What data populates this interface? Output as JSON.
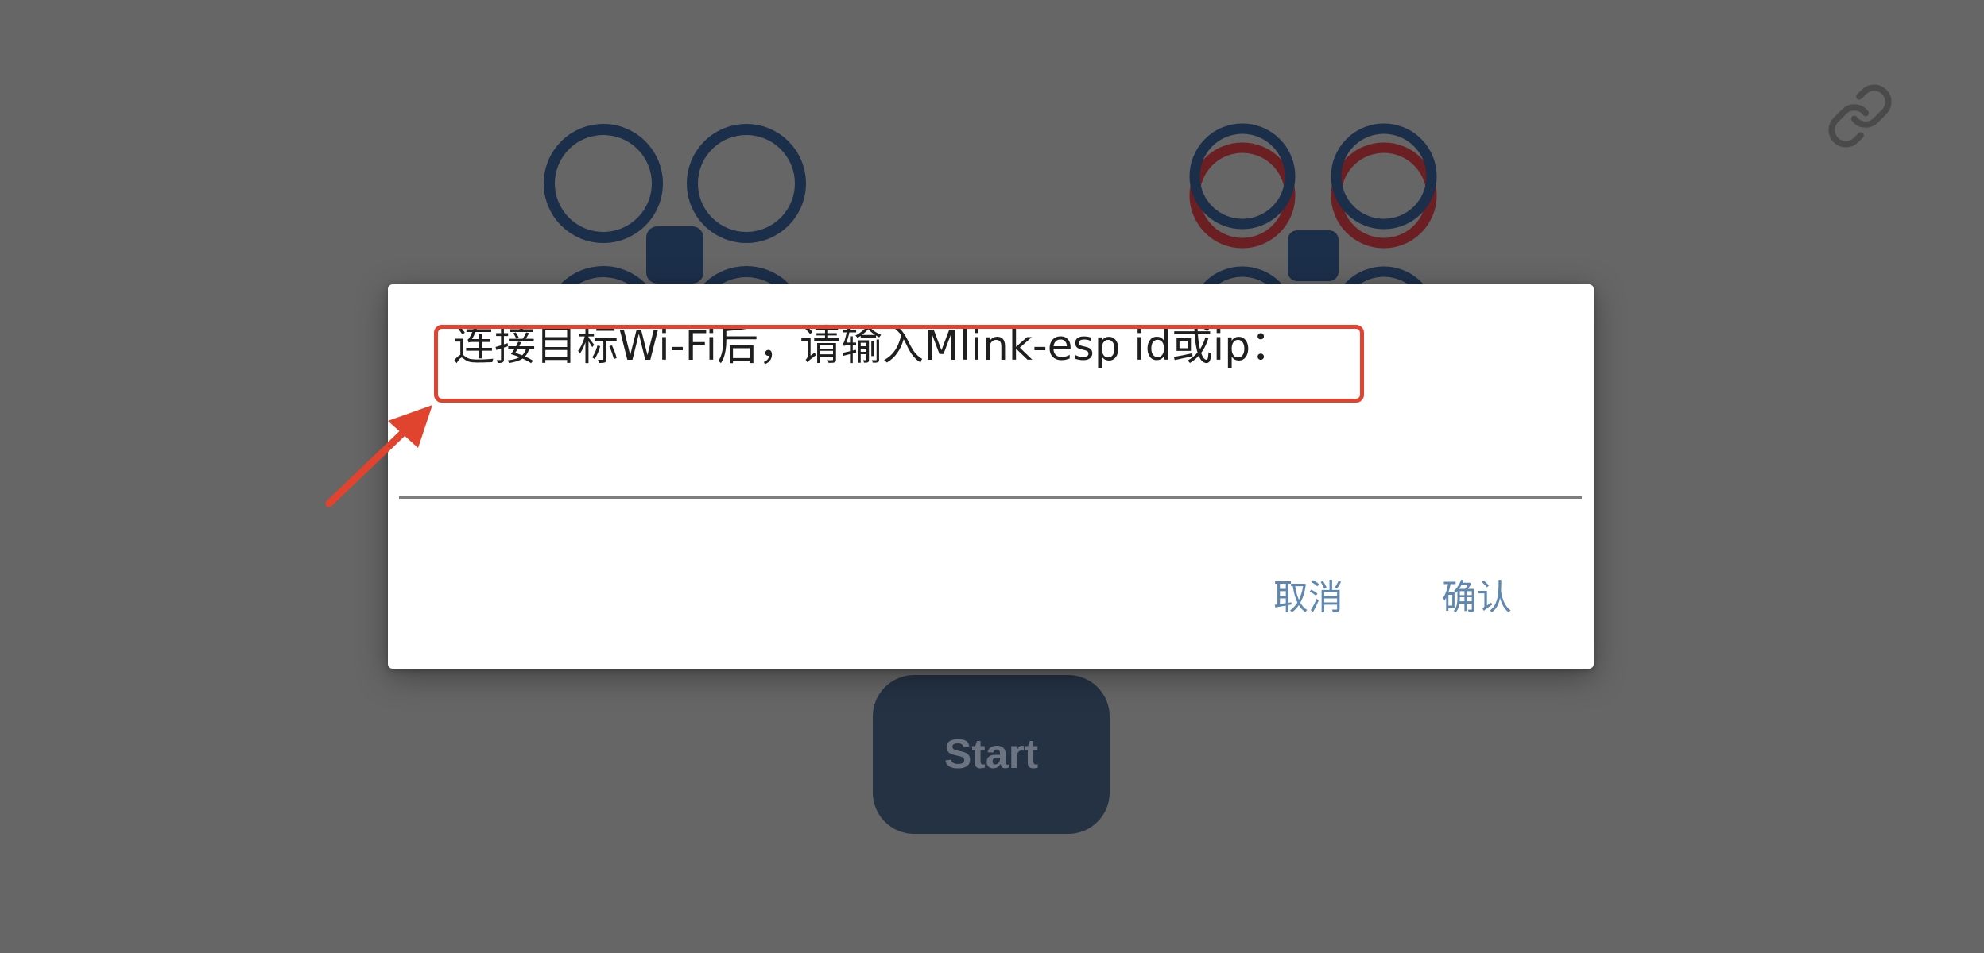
{
  "colors": {
    "background": "#666666",
    "drone_motor": "#1c2f4a",
    "drone_motor_active": "#6b1f23",
    "start_button_bg": "#243244",
    "start_button_text": "#6b7480",
    "dialog_button": "#5f87b0",
    "annotation": "#e0442f"
  },
  "toolbar": {
    "link_icon": "link-icon"
  },
  "main": {
    "start_label": "Start"
  },
  "dialog": {
    "title": "连接目标Wi-Fi后，请输入Mlink-esp id或ip：",
    "input_value": "",
    "input_placeholder": "",
    "cancel_label": "取消",
    "confirm_label": "确认"
  }
}
